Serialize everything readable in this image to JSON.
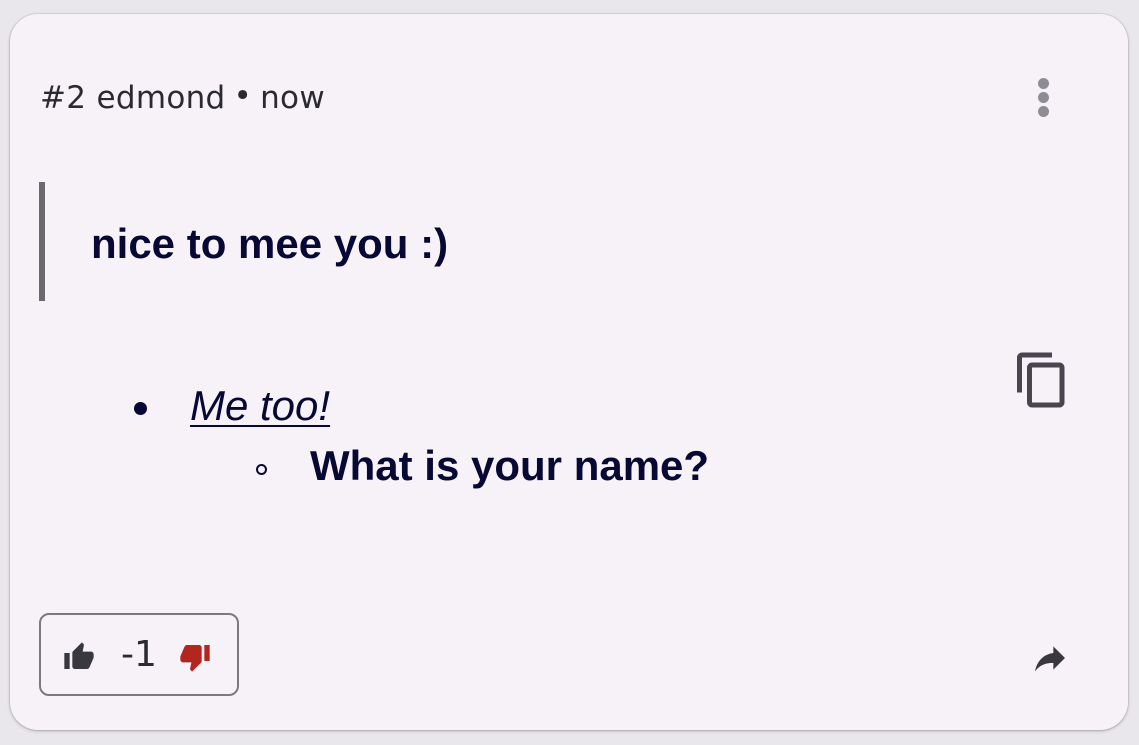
{
  "comment": {
    "number": "#2",
    "author": "edmond",
    "separator": "•",
    "time": "now"
  },
  "body": {
    "quote": "nice to mee you :)",
    "list": [
      {
        "text": "Me too!",
        "style": "italic-link",
        "children": [
          {
            "text": "What is your name?",
            "style": "bold"
          }
        ]
      }
    ]
  },
  "votes": {
    "count": "-1",
    "upvote_icon": "thumb-up-icon",
    "downvote_icon": "thumb-down-icon",
    "downvote_color": "#b3261e"
  },
  "icons": {
    "more": "more-vert-icon",
    "copy": "copy-icon",
    "share": "share-icon"
  },
  "colors": {
    "card_background": "#f6f2f8",
    "text_primary": "#080834",
    "meta_text": "#2b2a30",
    "quote_border": "#6c6872"
  }
}
